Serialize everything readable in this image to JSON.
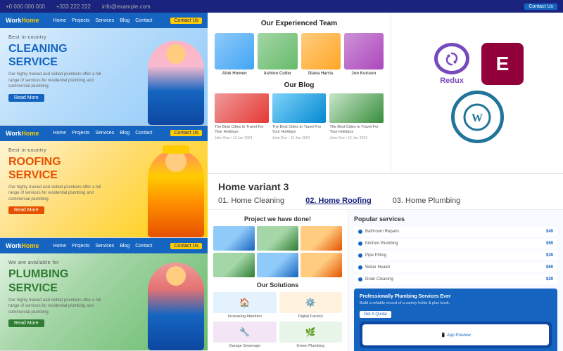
{
  "topbar": {
    "phone1": "+0 000 000 000",
    "phone2": "+333 222 222",
    "email": "info@example.com",
    "contact_label": "Contact Us"
  },
  "heroes": {
    "cleaning": {
      "badge": "Best in-country",
      "title_line1": "CLEANING",
      "title_line2": "SERVICE",
      "description": "Our highly trained and skilled plumbers offer a full range of services for residential plumbing and commercial plumbing.",
      "btn_label": "Read More",
      "nav_logo": "Work",
      "nav_logo_accent": "Home",
      "nav_items": [
        "Home",
        "Projects",
        "Services",
        "Blog",
        "Contact"
      ]
    },
    "roofing": {
      "badge": "Best in-country",
      "title_line1": "ROOFING",
      "title_line2": "SERVICE",
      "description": "Our highly trained and skilled plumbers offer a full range of services for residential plumbing and commercial plumbing.",
      "btn_label": "Read More"
    },
    "plumbing": {
      "badge": "We are available for",
      "title_line1": "PLUMBING",
      "title_line2": "SERVICE",
      "description": "Our highly trained and skilled plumbers offer a full range of services for residential plumbing and commercial plumbing.",
      "btn_label": "Read More"
    }
  },
  "team": {
    "section_title": "Our Experienced Team",
    "members": [
      {
        "name": "Alok Homen",
        "photo_class": "team-photo-1"
      },
      {
        "name": "Ashton Cutler",
        "photo_class": "team-photo-2"
      },
      {
        "name": "Diana Harris",
        "photo_class": "team-photo-3"
      },
      {
        "name": "Jon Kurison",
        "photo_class": "team-photo-4"
      }
    ]
  },
  "blog": {
    "section_title": "Our Blog",
    "posts": [
      {
        "title": "The Best Cities to Travel For Your Holidays",
        "meta": "John Doe • 12 Jan 2024",
        "img_class": "blog-img-1"
      },
      {
        "title": "The Best Cities to Travel For Your Holidays",
        "meta": "John Doe • 12 Jan 2024",
        "img_class": "blog-img-2"
      },
      {
        "title": "The Best Cities to Travel For Your Holidays",
        "meta": "John Doe • 12 Jan 2024",
        "img_class": "blog-img-3"
      }
    ]
  },
  "tech": {
    "redux_label": "Redux",
    "elementor_label": "E",
    "wp_label": "W"
  },
  "variant": {
    "title": "Home variant 3",
    "options": [
      {
        "id": "01",
        "label": "01. Home Cleaning"
      },
      {
        "id": "02",
        "label": "02. Home Roofing"
      },
      {
        "id": "03",
        "label": "03. Home Plumbing"
      }
    ]
  },
  "project": {
    "title": "Project we have done!",
    "solutions_title": "Our Solutions",
    "solutions": [
      {
        "label": "Increasing Attention",
        "icon": "🏠"
      },
      {
        "label": "Digital Factory",
        "icon": "⚙️"
      },
      {
        "label": "Garage Sewerage",
        "icon": "🔧"
      },
      {
        "label": "Green Plumbing",
        "icon": "🌿"
      }
    ]
  },
  "popular": {
    "title": "Popular services",
    "services": [
      {
        "text": "Bathroom Repairs",
        "price": "$49"
      },
      {
        "text": "Kitchen Plumbing",
        "price": "$59"
      },
      {
        "text": "Pipe Fitting",
        "price": "$39"
      },
      {
        "text": "Water Heater",
        "price": "$69"
      },
      {
        "text": "Drain Cleaning",
        "price": "$29"
      }
    ],
    "promo": {
      "title": "Professionally Plumbing Services Ever",
      "text": "Build a reliable record of a variety holds & plus book.",
      "btn_label": "Get A Quote"
    }
  }
}
